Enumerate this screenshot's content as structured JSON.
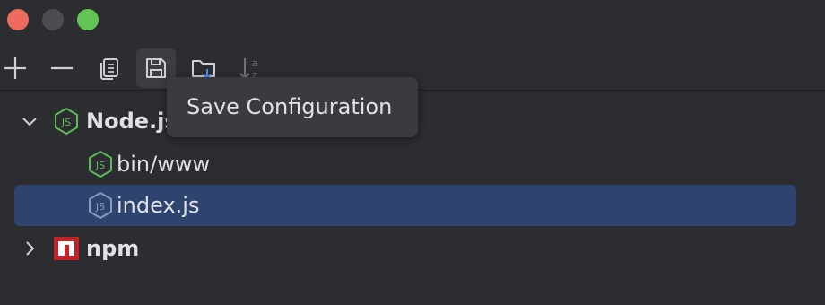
{
  "window": {
    "traffic_lights": {
      "close_color": "#ed6a5e",
      "minimize_color": "#4c4d50",
      "maximize_color": "#61c454"
    }
  },
  "toolbar": {
    "buttons": [
      {
        "name": "add",
        "icon": "plus-icon"
      },
      {
        "name": "remove",
        "icon": "minus-icon"
      },
      {
        "name": "copy",
        "icon": "copy-icon"
      },
      {
        "name": "save",
        "icon": "save-icon"
      },
      {
        "name": "move-to-folder",
        "icon": "folder-icon"
      },
      {
        "name": "sort",
        "icon": "sort-alpha-icon"
      }
    ]
  },
  "tooltip": {
    "text": "Save Configuration"
  },
  "tree": {
    "groups": [
      {
        "label": "Node.js",
        "expanded": true,
        "icon": "nodejs-icon",
        "children": [
          {
            "label": "bin/www",
            "icon": "nodejs-icon",
            "selected": false
          },
          {
            "label": "index.js",
            "icon": "nodejs-icon",
            "selected": true
          }
        ]
      },
      {
        "label": "npm",
        "expanded": false,
        "icon": "npm-icon",
        "children": []
      }
    ]
  },
  "colors": {
    "background": "#2b2d30",
    "selection": "#2e436e",
    "text": "#dfe1e5",
    "icon": "#ced0d6",
    "nodejs_green": "#5fb85a",
    "npm_red": "#c12127"
  }
}
